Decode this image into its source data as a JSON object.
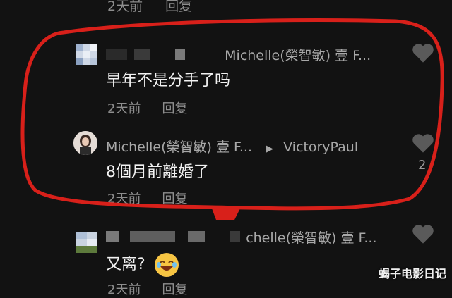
{
  "top_fragment": {
    "time": "2天前",
    "reply": "回复"
  },
  "comments": [
    {
      "author_target": "Michelle(榮智敏) 壹 F...",
      "text": "早年不是分手了吗",
      "time": "2天前",
      "reply": "回复"
    },
    {
      "author": "Michelle(榮智敏) 壹 F...",
      "arrow": "▶",
      "reply_to": "VictoryPaul",
      "text": "8個月前離婚了",
      "time": "2天前",
      "reply": "回复",
      "likes": "2"
    },
    {
      "author_target": "chelle(榮智敏) 壹 F...",
      "text": "又离?",
      "time": "2天前",
      "reply": "回复"
    }
  ],
  "watermark": "蝎子电影日记",
  "colors": {
    "annotation_red": "#d8201a",
    "bg": "#121212"
  }
}
